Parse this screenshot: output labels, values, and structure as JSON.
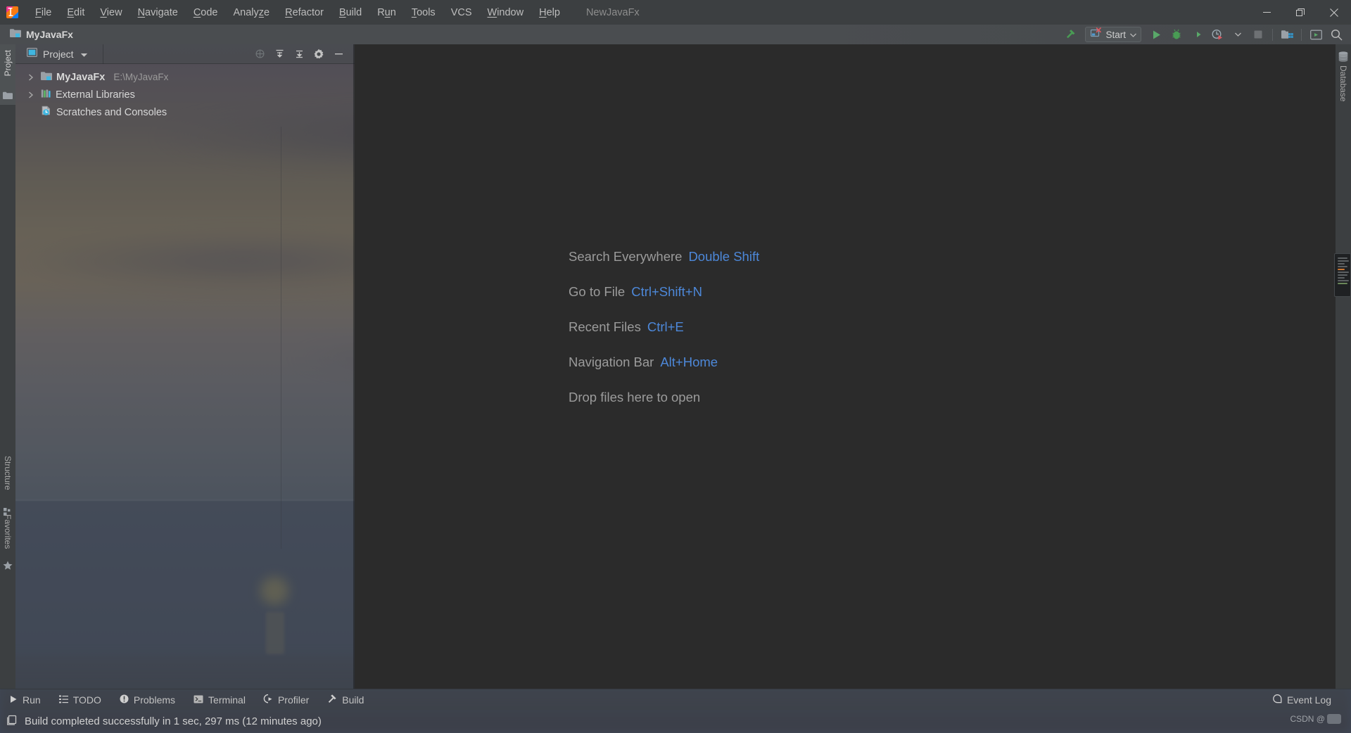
{
  "window": {
    "title": "NewJavaFx",
    "controls": {
      "minimize": "minimize-icon",
      "restore": "restore-icon",
      "close": "close-icon"
    }
  },
  "menubar": {
    "logo": "intellij-idea-logo",
    "items": [
      {
        "label": "File",
        "mnemonic": "F"
      },
      {
        "label": "Edit",
        "mnemonic": "E"
      },
      {
        "label": "View",
        "mnemonic": "V"
      },
      {
        "label": "Navigate",
        "mnemonic": "N"
      },
      {
        "label": "Code",
        "mnemonic": "C"
      },
      {
        "label": "Analyze",
        "mnemonic": "z"
      },
      {
        "label": "Refactor",
        "mnemonic": "R"
      },
      {
        "label": "Build",
        "mnemonic": "B"
      },
      {
        "label": "Run",
        "mnemonic": "u"
      },
      {
        "label": "Tools",
        "mnemonic": "T"
      },
      {
        "label": "VCS",
        "mnemonic": ""
      },
      {
        "label": "Window",
        "mnemonic": "W"
      },
      {
        "label": "Help",
        "mnemonic": "H"
      }
    ]
  },
  "navbar": {
    "breadcrumb": "MyJavaFx",
    "breadcrumb_icon": "project-folder-icon",
    "toolbar": {
      "build_icon": "build-hammer-icon",
      "run_config": {
        "label": "Start",
        "icon": "run-config-error-icon",
        "dropdown": "chevron-down-icon"
      },
      "run_icon": "run-play-icon",
      "debug_icon": "debug-bug-icon",
      "coverage_icon": "run-with-coverage-icon",
      "profiler_icon": "profiler-clock-icon",
      "profiler_dropdown": "chevron-down-icon",
      "stop_icon": "stop-square-icon",
      "project_structure_icon": "project-structure-icon",
      "notifications_icon": "updates-icon",
      "search_icon": "search-icon"
    }
  },
  "tool_strips": {
    "left_top": [
      {
        "label": "Project",
        "icon": "project-icon",
        "active": true
      }
    ],
    "left_bottom": [
      {
        "label": "Structure",
        "icon": "structure-icon"
      },
      {
        "label": "Favorites",
        "icon": "star-icon"
      }
    ],
    "right_top": [
      {
        "label": "Database",
        "icon": "database-icon"
      }
    ]
  },
  "project_panel": {
    "tab_label": "Project",
    "tab_icon": "project-view-icon",
    "actions": [
      {
        "name": "locate-icon",
        "title": "Select Opened File"
      },
      {
        "name": "expand-all-icon",
        "title": "Expand All"
      },
      {
        "name": "collapse-all-icon",
        "title": "Collapse All"
      },
      {
        "name": "gear-icon",
        "title": "Settings"
      },
      {
        "name": "hide-icon",
        "title": "Hide"
      }
    ],
    "tree": [
      {
        "label": "MyJavaFx",
        "path": "E:\\MyJavaFx",
        "icon": "project-folder-icon",
        "expandable": true,
        "bold": true
      },
      {
        "label": "External Libraries",
        "path": "",
        "icon": "libraries-icon",
        "expandable": true,
        "bold": false
      },
      {
        "label": "Scratches and Consoles",
        "path": "",
        "icon": "scratches-icon",
        "expandable": false,
        "bold": false
      }
    ]
  },
  "editor": {
    "hints": [
      {
        "label": "Search Everywhere",
        "key": "Double Shift"
      },
      {
        "label": "Go to File",
        "key": "Ctrl+Shift+N"
      },
      {
        "label": "Recent Files",
        "key": "Ctrl+E"
      },
      {
        "label": "Navigation Bar",
        "key": "Alt+Home"
      },
      {
        "label": "Drop files here to open",
        "key": ""
      }
    ]
  },
  "bottom_bar": {
    "tabs": [
      {
        "label": "Run",
        "icon": "run-play-icon"
      },
      {
        "label": "TODO",
        "icon": "todo-list-icon"
      },
      {
        "label": "Problems",
        "icon": "problems-warning-icon"
      },
      {
        "label": "Terminal",
        "icon": "terminal-icon"
      },
      {
        "label": "Profiler",
        "icon": "profiler-icon"
      },
      {
        "label": "Build",
        "icon": "build-hammer-icon"
      }
    ],
    "event_log": {
      "label": "Event Log",
      "icon": "event-log-icon"
    }
  },
  "status_bar": {
    "icon": "build-status-icon",
    "message": "Build completed successfully in 1 sec, 297 ms (12 minutes ago)",
    "watermark": "CSDN @"
  },
  "colors": {
    "accent_blue": "#4d88d9",
    "panel_bg": "#3c3f41",
    "editor_bg": "#2b2b2b",
    "run_green": "#59a869",
    "error_red": "#db5860"
  }
}
